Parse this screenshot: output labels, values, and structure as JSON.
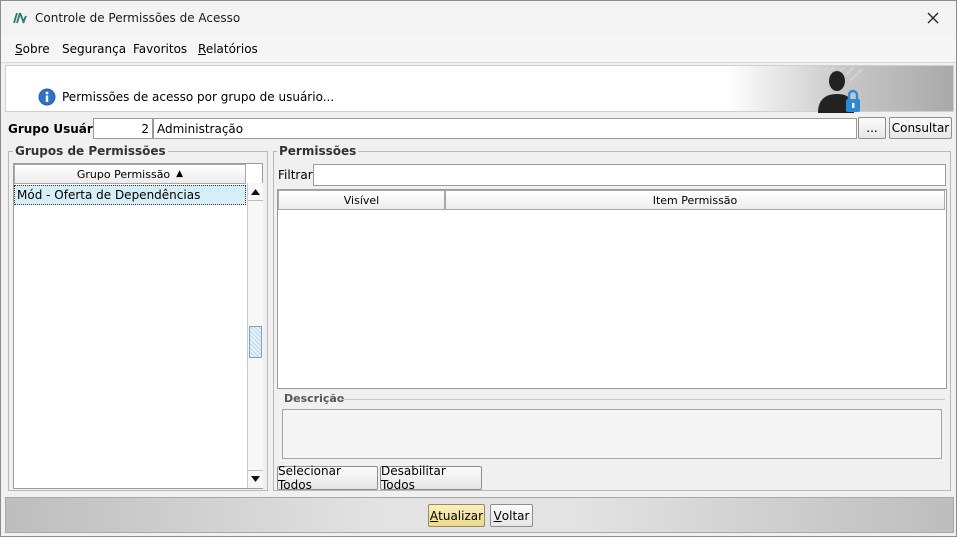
{
  "window": {
    "title": "Controle de Permissões de Acesso",
    "logo_icon": "app-logo-icon",
    "close_icon": "close-icon"
  },
  "menu": {
    "items": [
      {
        "label_first": "S",
        "label_rest": "obre"
      },
      {
        "label_first": "",
        "label_rest": "Segurança"
      },
      {
        "label_first": "",
        "label_rest": "Favoritos"
      },
      {
        "label_first": "R",
        "label_rest": "elatórios"
      }
    ]
  },
  "banner": {
    "text": "Permissões de acesso por grupo de usuário...",
    "info_icon": "info-icon",
    "user_icon": "user-lock-icon"
  },
  "grupo_usuario": {
    "label": "Grupo Usuário:",
    "id_value": "2",
    "name_value": "Administração",
    "browse_label": "...",
    "consultar_label": "Consultar"
  },
  "grupos_permissoes": {
    "title": "Grupos de Permissões",
    "column_header": "Grupo Permissão",
    "sort_indicator": "▲",
    "rows": [
      "Mód - Oferta de Dependências"
    ]
  },
  "permissoes": {
    "title": "Permissões",
    "filter_label": "Filtrar:",
    "filter_value": "",
    "columns": [
      "Visível",
      "Item Permissão"
    ],
    "descricao_title": "Descrição",
    "descricao_value": "",
    "select_all_label": "Selecionar Todos",
    "disable_all_label": "Desabilitar Todos"
  },
  "footer": {
    "atualizar_first": "A",
    "atualizar_rest": "tualizar",
    "voltar_first": "V",
    "voltar_rest": "oltar"
  },
  "colors": {
    "selected_row": "#d6eef5",
    "info_blue": "#1f5fae",
    "lock_blue": "#2a8ad8",
    "default_button": "#f6eaa8"
  }
}
